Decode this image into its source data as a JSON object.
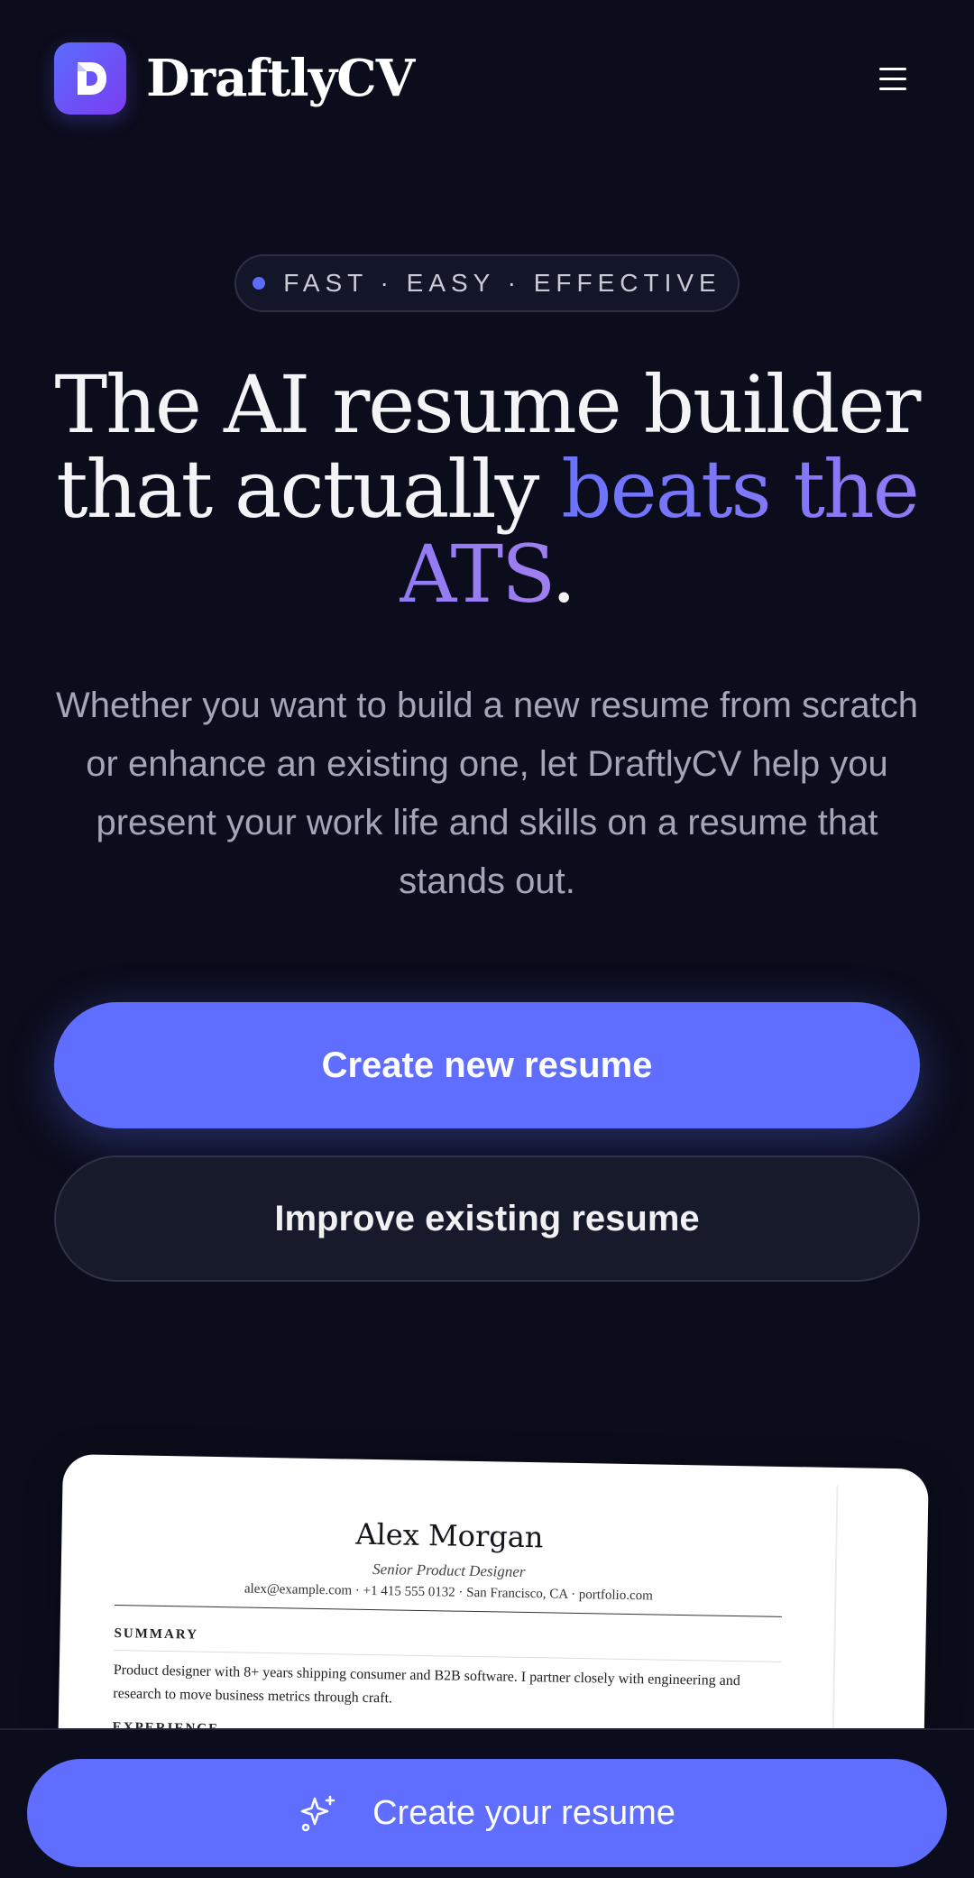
{
  "header": {
    "brand_name": "DraftlyCV",
    "logo_letter": "D"
  },
  "badge": {
    "text": "FAST · EASY · EFFECTIVE"
  },
  "hero": {
    "headline_part1": "The AI resume builder that actually ",
    "headline_highlight": "beats the ATS",
    "headline_end": ".",
    "subtitle": "Whether you want to build a new resume from scratch or enhance an existing one, let DraftlyCV help you present your work life and skills on a resume that stands out."
  },
  "actions": {
    "primary_label": "Create new resume",
    "secondary_label": "Improve existing resume"
  },
  "resume_preview": {
    "name": "Alex Morgan",
    "title": "Senior Product Designer",
    "contact": "alex@example.com · +1 415 555 0132 · San Francisco, CA · portfolio.com",
    "summary_heading": "SUMMARY",
    "summary_text": "Product designer with 8+ years shipping consumer and B2B software. I partner closely with engineering and research to move business metrics through craft.",
    "experience_heading": "EXPERIENCE"
  },
  "bottom_cta": {
    "label": "Create your resume",
    "icon": "sparkle-icon"
  },
  "colors": {
    "background": "#0b0d1c",
    "accent": "#5f6eff",
    "gradient_start": "#6b73ff",
    "gradient_end": "#a07ef0"
  }
}
